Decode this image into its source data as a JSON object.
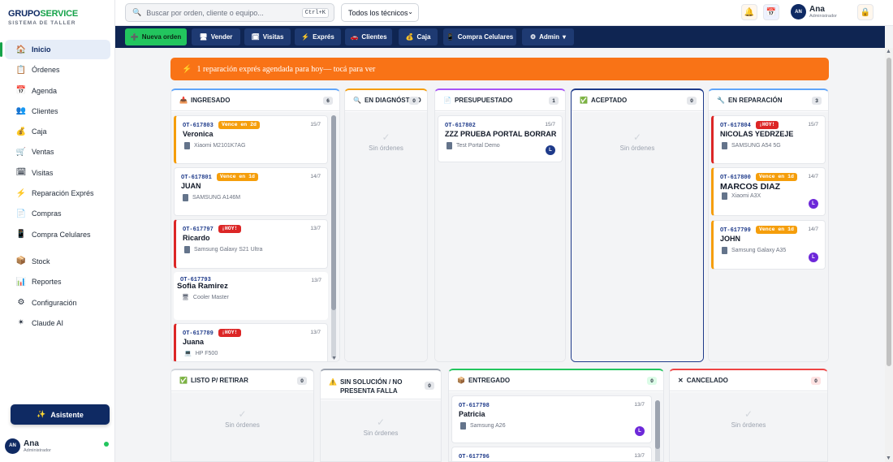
{
  "brand": {
    "name_a": "GRUPO",
    "name_b": "SERVICE",
    "subtitle": "SISTEMA DE TALLER"
  },
  "sidebar": {
    "items": [
      {
        "label": "Inicio",
        "icon": "🏠",
        "icon_name": "home-icon",
        "active": true
      },
      {
        "label": "Órdenes",
        "icon": "📋",
        "icon_name": "orders-icon"
      },
      {
        "label": "Agenda",
        "icon": "📅",
        "icon_name": "calendar-icon"
      },
      {
        "label": "Clientes",
        "icon": "👥",
        "icon_name": "clients-icon"
      },
      {
        "label": "Caja",
        "icon": "💰",
        "icon_name": "cash-icon"
      },
      {
        "label": "Ventas",
        "icon": "🛒",
        "icon_name": "cart-icon"
      },
      {
        "label": "Visitas",
        "icon": "🗓",
        "icon_name": "visits-icon"
      },
      {
        "label": "Reparación Exprés",
        "icon": "⚡",
        "icon_name": "lightning-icon"
      },
      {
        "label": "Compras",
        "icon": "📄",
        "icon_name": "purchases-icon"
      },
      {
        "label": "Compra Celulares",
        "icon": "📱",
        "icon_name": "phone-icon"
      },
      {
        "label": "Stock",
        "icon": "📦",
        "icon_name": "box-icon"
      },
      {
        "label": "Reportes",
        "icon": "📊",
        "icon_name": "reports-icon"
      },
      {
        "label": "Configuración",
        "icon": "⚙",
        "icon_name": "gear-icon"
      },
      {
        "label": "Claude AI",
        "icon": "✴",
        "icon_name": "ai-icon"
      }
    ],
    "assistant_label": "Asistente",
    "user": {
      "initials": "AN",
      "name": "Ana",
      "role": "Administrador"
    }
  },
  "topbar": {
    "search_placeholder": "Buscar por orden, cliente o equipo...",
    "search_shortcut": "Ctrl+K",
    "tech_filter": "Todos los técnicos",
    "user": {
      "initials": "AN",
      "name": "Ana",
      "role": "Administrador"
    }
  },
  "navstrip": [
    {
      "label": "Nueva orden",
      "icon": "➕"
    },
    {
      "label": "Vender",
      "icon": "🖥"
    },
    {
      "label": "Visitas",
      "icon": "🗓"
    },
    {
      "label": "Exprés",
      "icon": "⚡"
    },
    {
      "label": "Clientes",
      "icon": "🚗"
    },
    {
      "label": "Caja",
      "icon": "💰"
    },
    {
      "label": "Compra Celulares",
      "icon": "📱"
    },
    {
      "label": "Admin",
      "icon": "⚙"
    }
  ],
  "alert": {
    "text": "1 reparación exprés agendada para hoy— tocá para ver"
  },
  "empty_text": "Sin órdenes",
  "columns": {
    "ingresado": {
      "title": "INGRESADO",
      "count": "6",
      "color": "#60a5fa"
    },
    "diagnostico": {
      "title": "EN DIAGNÓSTICO",
      "count": "0",
      "color": "#f59e0b"
    },
    "presupuestado": {
      "title": "PRESUPUESTADO",
      "count": "1",
      "color": "#a855f7"
    },
    "aceptado": {
      "title": "ACEPTADO",
      "count": "0",
      "color": "#1e3a8a"
    },
    "reparacion": {
      "title": "EN REPARACIÓN",
      "count": "3",
      "color": "#60a5fa"
    },
    "listo": {
      "title": "LISTO P/ RETIRAR",
      "count": "0",
      "color": "#d1d5db"
    },
    "sinsolucion": {
      "title": "SIN SOLUCIÓN / NO PRESENTA FALLA",
      "count": "0",
      "color": "#9ca3af"
    },
    "entregado": {
      "title": "ENTREGADO",
      "count": "0",
      "color": "#22c55e"
    },
    "cancelado": {
      "title": "CANCELADO",
      "count": "0",
      "color": "#ef4444"
    }
  },
  "cards": {
    "c1": {
      "ot": "OT-617803",
      "badge": "Vence en 2d",
      "date": "15/7",
      "name": "Veronica",
      "device": "Xiaomi M2101K7AG"
    },
    "c2": {
      "ot": "OT-617801",
      "badge": "Vence en 1d",
      "date": "14/7",
      "name": "JUAN",
      "device": "SAMSUNG A146M"
    },
    "c3": {
      "ot": "OT-617797",
      "badge": "¡HOY!",
      "date": "13/7",
      "name": "Ricardo",
      "device": "Samsung Galaxy S21 Ultra"
    },
    "c4": {
      "ot": "OT-617793",
      "date": "13/7",
      "name": "Sofia Ramirez",
      "device": "Cooler Master"
    },
    "c5": {
      "ot": "OT-617789",
      "badge": "¡HOY!",
      "date": "13/7",
      "name": "Juana",
      "device": "HP F500"
    },
    "c6": {
      "ot": "OT-617802",
      "date": "15/7",
      "name": "ZZZ PRUEBA PORTAL BORRAR",
      "device": "Test Portal Demo",
      "tech": "L"
    },
    "c7": {
      "ot": "OT-617804",
      "badge": "¡HOY!",
      "date": "15/7",
      "name": "NICOLAS YEDRZEJE",
      "device": "SAMSUNG A54 5G"
    },
    "c8": {
      "ot": "OT-617800",
      "badge": "Vence en 1d",
      "date": "14/7",
      "name": "MARCOS DIAZ",
      "device": "Xiaomi A3X",
      "tech": "L"
    },
    "c9": {
      "ot": "OT-617799",
      "badge": "Vence en 1d",
      "date": "14/7",
      "name": "JOHN",
      "device": "Samsung Galaxy A35",
      "tech": "L"
    },
    "c10": {
      "ot": "OT-617798",
      "date": "13/7",
      "name": "Patricia",
      "device": "Samsung A26",
      "tech": "L"
    },
    "c11": {
      "ot": "OT-617796",
      "date": "13/7"
    }
  }
}
